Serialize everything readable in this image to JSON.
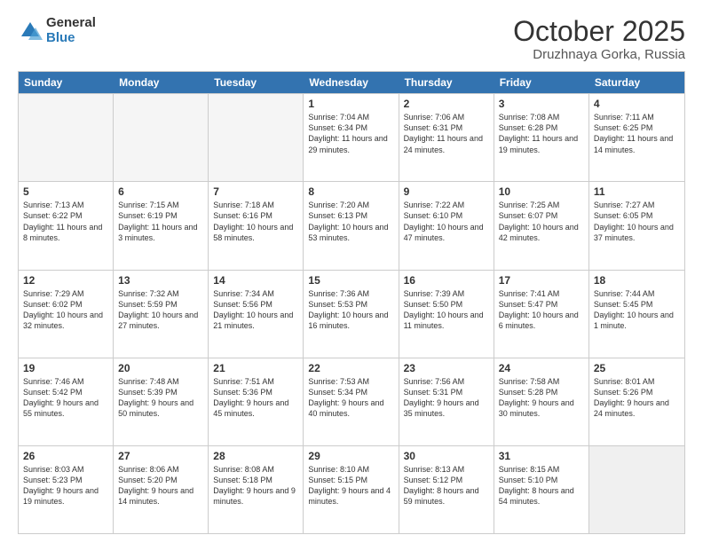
{
  "logo": {
    "general": "General",
    "blue": "Blue"
  },
  "title": "October 2025",
  "location": "Druzhnaya Gorka, Russia",
  "weekdays": [
    "Sunday",
    "Monday",
    "Tuesday",
    "Wednesday",
    "Thursday",
    "Friday",
    "Saturday"
  ],
  "rows": [
    [
      {
        "day": "",
        "text": "",
        "empty": true
      },
      {
        "day": "",
        "text": "",
        "empty": true
      },
      {
        "day": "",
        "text": "",
        "empty": true
      },
      {
        "day": "1",
        "text": "Sunrise: 7:04 AM\nSunset: 6:34 PM\nDaylight: 11 hours and 29 minutes."
      },
      {
        "day": "2",
        "text": "Sunrise: 7:06 AM\nSunset: 6:31 PM\nDaylight: 11 hours and 24 minutes."
      },
      {
        "day": "3",
        "text": "Sunrise: 7:08 AM\nSunset: 6:28 PM\nDaylight: 11 hours and 19 minutes."
      },
      {
        "day": "4",
        "text": "Sunrise: 7:11 AM\nSunset: 6:25 PM\nDaylight: 11 hours and 14 minutes."
      }
    ],
    [
      {
        "day": "5",
        "text": "Sunrise: 7:13 AM\nSunset: 6:22 PM\nDaylight: 11 hours and 8 minutes."
      },
      {
        "day": "6",
        "text": "Sunrise: 7:15 AM\nSunset: 6:19 PM\nDaylight: 11 hours and 3 minutes."
      },
      {
        "day": "7",
        "text": "Sunrise: 7:18 AM\nSunset: 6:16 PM\nDaylight: 10 hours and 58 minutes."
      },
      {
        "day": "8",
        "text": "Sunrise: 7:20 AM\nSunset: 6:13 PM\nDaylight: 10 hours and 53 minutes."
      },
      {
        "day": "9",
        "text": "Sunrise: 7:22 AM\nSunset: 6:10 PM\nDaylight: 10 hours and 47 minutes."
      },
      {
        "day": "10",
        "text": "Sunrise: 7:25 AM\nSunset: 6:07 PM\nDaylight: 10 hours and 42 minutes."
      },
      {
        "day": "11",
        "text": "Sunrise: 7:27 AM\nSunset: 6:05 PM\nDaylight: 10 hours and 37 minutes."
      }
    ],
    [
      {
        "day": "12",
        "text": "Sunrise: 7:29 AM\nSunset: 6:02 PM\nDaylight: 10 hours and 32 minutes."
      },
      {
        "day": "13",
        "text": "Sunrise: 7:32 AM\nSunset: 5:59 PM\nDaylight: 10 hours and 27 minutes."
      },
      {
        "day": "14",
        "text": "Sunrise: 7:34 AM\nSunset: 5:56 PM\nDaylight: 10 hours and 21 minutes."
      },
      {
        "day": "15",
        "text": "Sunrise: 7:36 AM\nSunset: 5:53 PM\nDaylight: 10 hours and 16 minutes."
      },
      {
        "day": "16",
        "text": "Sunrise: 7:39 AM\nSunset: 5:50 PM\nDaylight: 10 hours and 11 minutes."
      },
      {
        "day": "17",
        "text": "Sunrise: 7:41 AM\nSunset: 5:47 PM\nDaylight: 10 hours and 6 minutes."
      },
      {
        "day": "18",
        "text": "Sunrise: 7:44 AM\nSunset: 5:45 PM\nDaylight: 10 hours and 1 minute."
      }
    ],
    [
      {
        "day": "19",
        "text": "Sunrise: 7:46 AM\nSunset: 5:42 PM\nDaylight: 9 hours and 55 minutes."
      },
      {
        "day": "20",
        "text": "Sunrise: 7:48 AM\nSunset: 5:39 PM\nDaylight: 9 hours and 50 minutes."
      },
      {
        "day": "21",
        "text": "Sunrise: 7:51 AM\nSunset: 5:36 PM\nDaylight: 9 hours and 45 minutes."
      },
      {
        "day": "22",
        "text": "Sunrise: 7:53 AM\nSunset: 5:34 PM\nDaylight: 9 hours and 40 minutes."
      },
      {
        "day": "23",
        "text": "Sunrise: 7:56 AM\nSunset: 5:31 PM\nDaylight: 9 hours and 35 minutes."
      },
      {
        "day": "24",
        "text": "Sunrise: 7:58 AM\nSunset: 5:28 PM\nDaylight: 9 hours and 30 minutes."
      },
      {
        "day": "25",
        "text": "Sunrise: 8:01 AM\nSunset: 5:26 PM\nDaylight: 9 hours and 24 minutes."
      }
    ],
    [
      {
        "day": "26",
        "text": "Sunrise: 8:03 AM\nSunset: 5:23 PM\nDaylight: 9 hours and 19 minutes."
      },
      {
        "day": "27",
        "text": "Sunrise: 8:06 AM\nSunset: 5:20 PM\nDaylight: 9 hours and 14 minutes."
      },
      {
        "day": "28",
        "text": "Sunrise: 8:08 AM\nSunset: 5:18 PM\nDaylight: 9 hours and 9 minutes."
      },
      {
        "day": "29",
        "text": "Sunrise: 8:10 AM\nSunset: 5:15 PM\nDaylight: 9 hours and 4 minutes."
      },
      {
        "day": "30",
        "text": "Sunrise: 8:13 AM\nSunset: 5:12 PM\nDaylight: 8 hours and 59 minutes."
      },
      {
        "day": "31",
        "text": "Sunrise: 8:15 AM\nSunset: 5:10 PM\nDaylight: 8 hours and 54 minutes."
      },
      {
        "day": "",
        "text": "",
        "empty": true,
        "shaded": true
      }
    ]
  ]
}
